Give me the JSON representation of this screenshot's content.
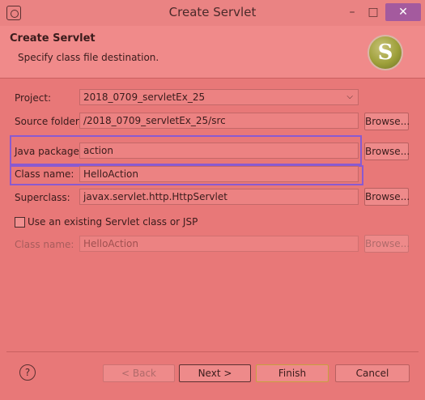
{
  "window": {
    "title": "Create Servlet",
    "minimize": "–",
    "maximize": "□",
    "close": "✕"
  },
  "header": {
    "title": "Create Servlet",
    "description": "Specify class file destination.",
    "logo_letter": "S"
  },
  "form": {
    "project": {
      "label": "Project:",
      "value": "2018_0709_servletEx_25"
    },
    "source_folder": {
      "label": "Source folder:",
      "value": "/2018_0709_servletEx_25/src",
      "browse": "Browse..."
    },
    "java_package": {
      "label": "Java package:",
      "value": "action",
      "browse": "Browse..."
    },
    "class_name": {
      "label": "Class name:",
      "value": "HelloAction"
    },
    "superclass": {
      "label": "Superclass:",
      "value": "javax.servlet.http.HttpServlet",
      "browse": "Browse..."
    },
    "use_existing": {
      "label": "Use an existing Servlet class or JSP",
      "checked": false
    },
    "existing_class_name": {
      "label": "Class name:",
      "value": "HelloAction",
      "browse": "Browse..."
    }
  },
  "footer": {
    "help": "?",
    "back": "< Back",
    "next": "Next >",
    "finish": "Finish",
    "cancel": "Cancel"
  },
  "colors": {
    "background": "#e87878",
    "highlight": "#8a5ad0",
    "close_button": "#a45a9e"
  }
}
